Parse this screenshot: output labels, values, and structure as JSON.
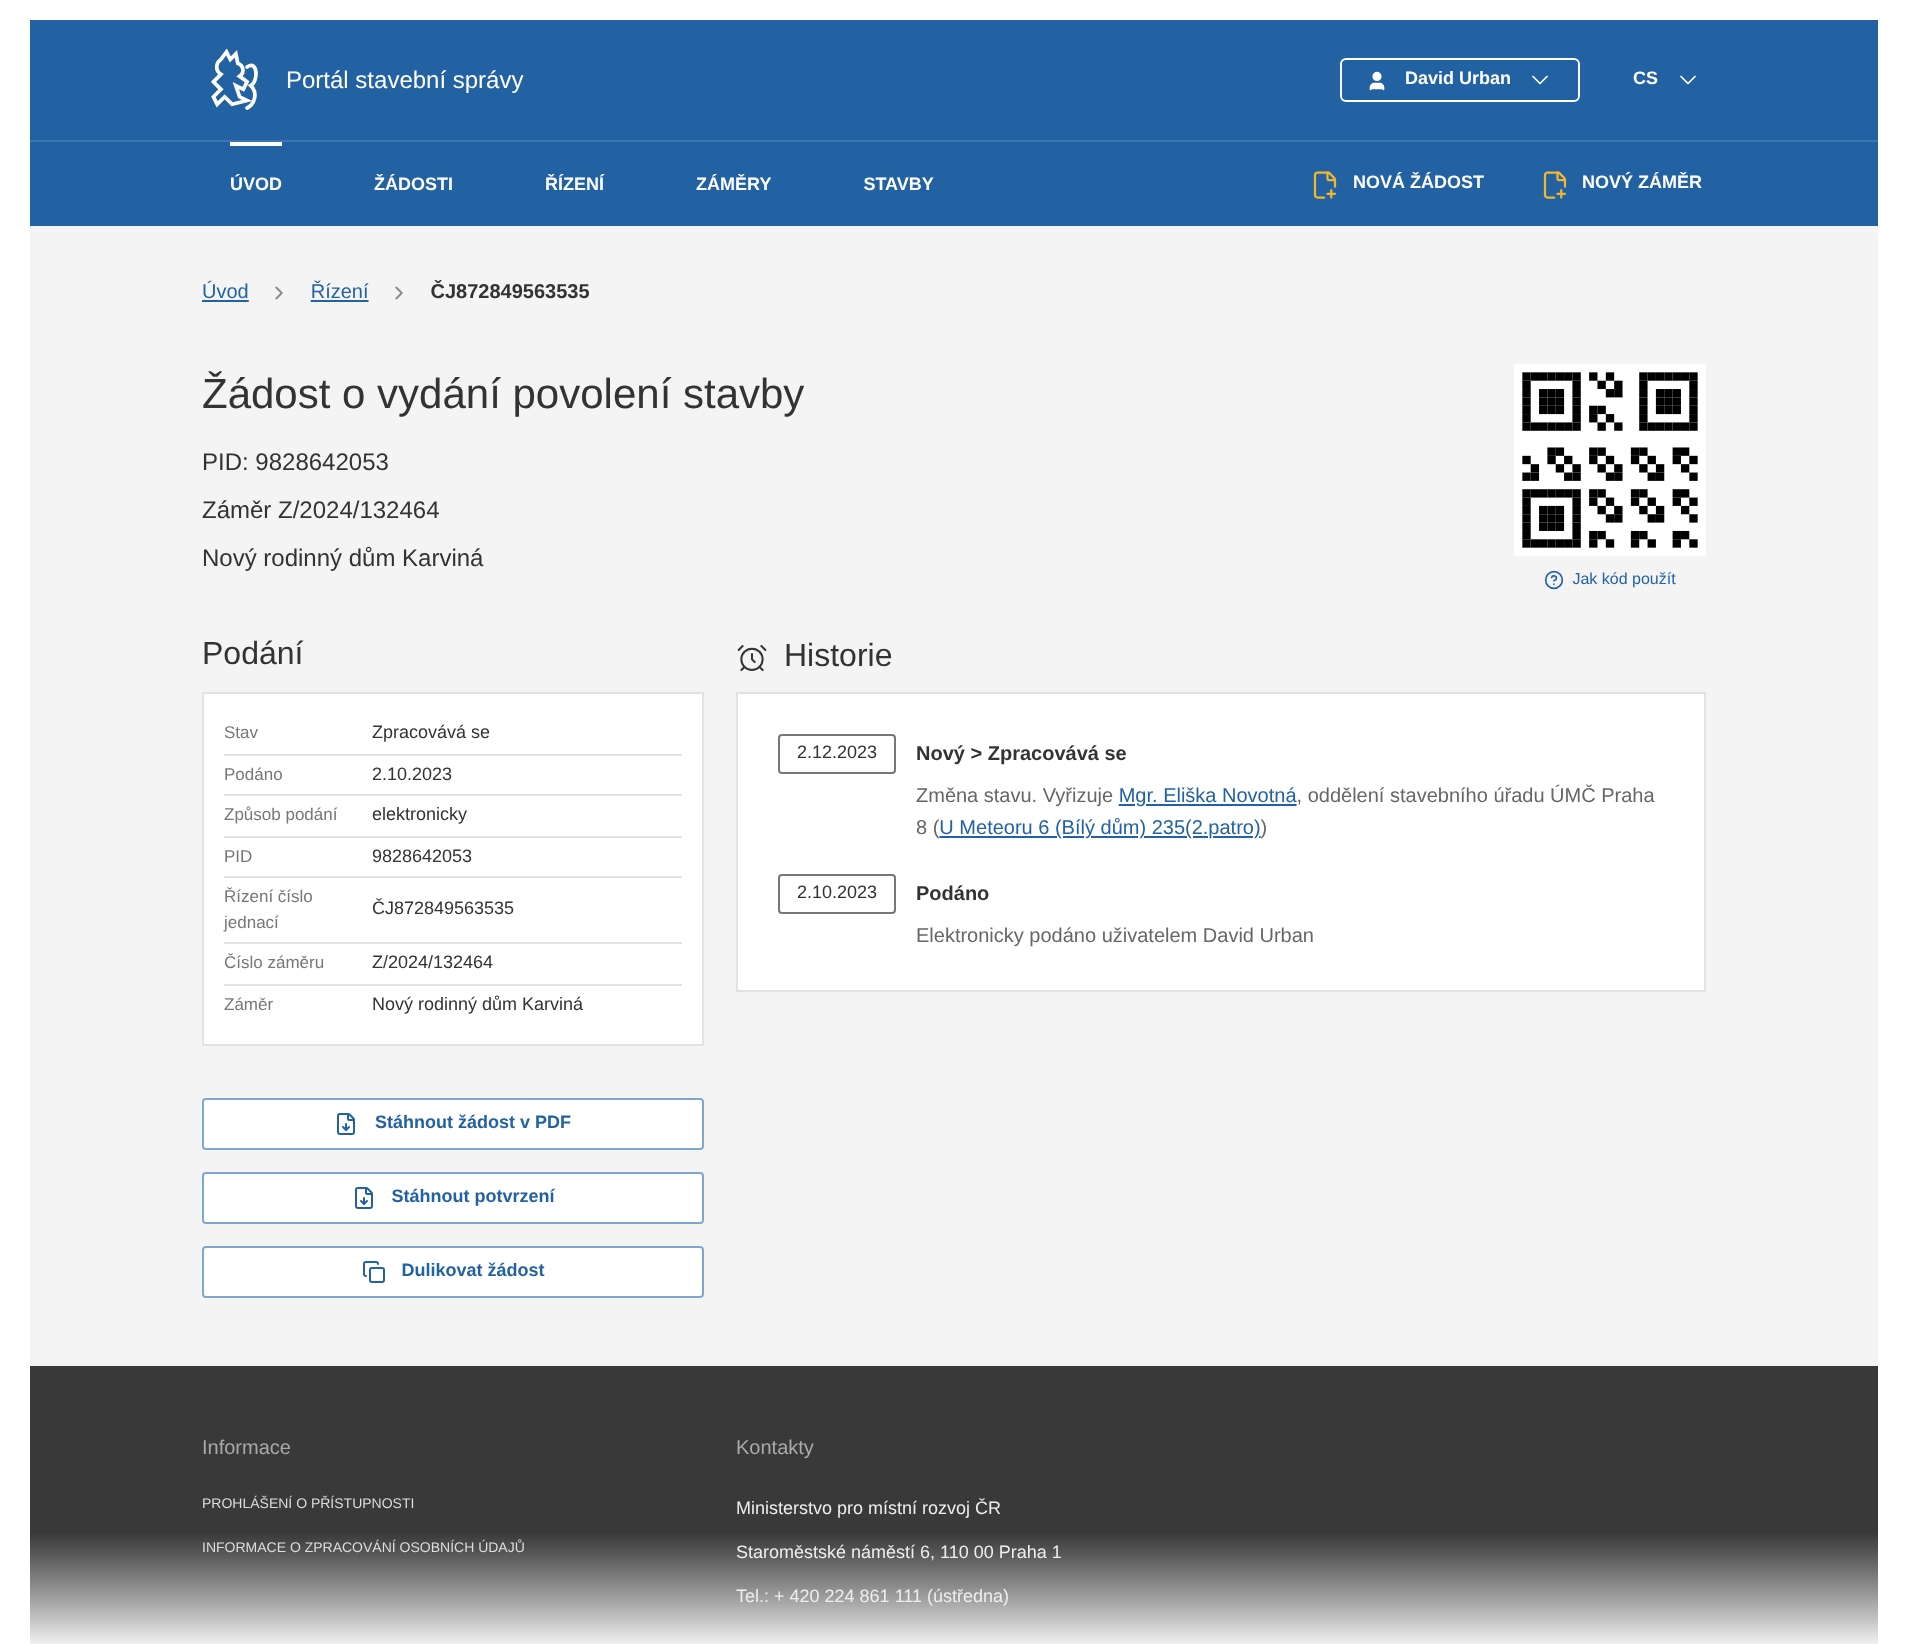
{
  "header": {
    "title": "Portál stavební správy",
    "user": "David Urban",
    "language": "CS"
  },
  "nav": {
    "items": [
      {
        "label": "ÚVOD",
        "selected": true
      },
      {
        "label": "ŽÁDOSTI",
        "selected": false
      },
      {
        "label": "ŘÍZENÍ",
        "selected": false
      },
      {
        "label": "ZÁMĚRY",
        "selected": false
      },
      {
        "label": "STAVBY",
        "selected": false
      }
    ],
    "actions": [
      "NOVÁ ŽÁDOST",
      "NOVÝ ZÁMĚR"
    ]
  },
  "breadcrumbs": [
    {
      "label": "Úvod",
      "kind": "link"
    },
    {
      "label": "Řízení",
      "kind": "link"
    },
    {
      "label": "ČJ872849563535",
      "kind": "current"
    }
  ],
  "page": {
    "title": "Žádost o vydání povolení stavby",
    "lines": [
      "PID: 9828642053",
      "Záměr Z/2024/132464",
      "Nový rodinný dům Karviná"
    ],
    "qr_help": "Jak kód použít"
  },
  "podani": {
    "heading": "Podání",
    "rows": [
      {
        "label": "Stav",
        "value": "Zpracovává se"
      },
      {
        "label": "Podáno",
        "value": "2.10.2023"
      },
      {
        "label": "Způsob podání",
        "value": "elektronicky"
      },
      {
        "label": "PID",
        "value": "9828642053"
      },
      {
        "label": "Řízení číslo jednací",
        "value": "ČJ872849563535"
      },
      {
        "label": "Číslo záměru",
        "value": "Z/2024/132464"
      },
      {
        "label": "Záměr",
        "value": "Nový rodinný dům Karviná"
      }
    ],
    "buttons": [
      {
        "label": "Stáhnout žádost v PDF",
        "kind": "download"
      },
      {
        "label": "Stáhnout potvrzení",
        "kind": "download"
      },
      {
        "label": "Dulikovat žádost",
        "kind": "copy"
      }
    ]
  },
  "historie": {
    "heading": "Historie",
    "entries": [
      {
        "date": "2.12.2023",
        "title": "Nový > Zpracovává se",
        "parts": [
          {
            "text": "Změna stavu. Vyřizuje ",
            "kind": "text"
          },
          {
            "text": "Mgr. Eliška Novotná",
            "kind": "link"
          },
          {
            "text": ", oddělení stavebního úřadu ÚMČ Praha 8 (",
            "kind": "text"
          },
          {
            "text": "U Meteoru 6 (Bílý dům) 235(2.patro)",
            "kind": "link"
          },
          {
            "text": ")",
            "kind": "text"
          }
        ]
      },
      {
        "date": "2.10.2023",
        "title": "Podáno",
        "parts": [
          {
            "text": "Elektronicky podáno uživatelem David Urban",
            "kind": "text"
          }
        ]
      }
    ]
  },
  "footer": {
    "columns": [
      {
        "heading": "Informace",
        "items": [
          {
            "text": "PROHLÁŠENÍ O PŘÍSTUPNOSTI",
            "kind": "link"
          },
          {
            "text": "INFORMACE O ZPRACOVÁNÍ OSOBNÍCH ÚDAJŮ",
            "kind": "link"
          }
        ]
      },
      {
        "heading": "Kontakty",
        "items": [
          {
            "text": "Ministerstvo pro místní rozvoj ČR",
            "kind": "text"
          },
          {
            "text": "Staroměstské náměstí 6, 110 00 Praha 1",
            "kind": "text"
          },
          {
            "text": "Tel.: + 420 224 861 111 (ústředna)",
            "kind": "text"
          }
        ]
      }
    ]
  }
}
